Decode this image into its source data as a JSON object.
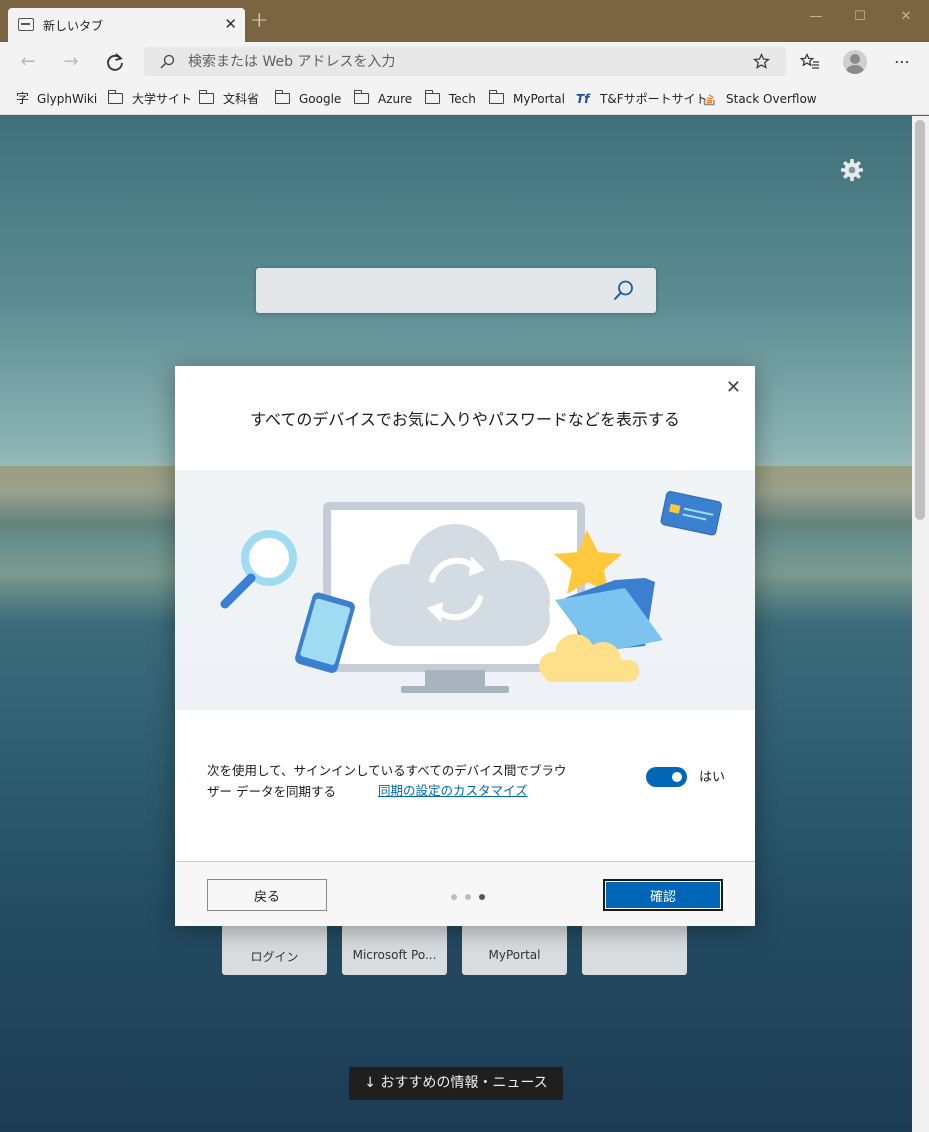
{
  "window": {
    "tab_title": "新しいタブ",
    "tab_close": "✕",
    "new_tab": "+",
    "controls": [
      "—",
      "☐",
      "✕"
    ]
  },
  "toolbar": {
    "back": "←",
    "forward": "→",
    "address_placeholder": "検索または Web アドレスを入力"
  },
  "bookmarks": [
    {
      "label": "GlyphWiki",
      "icon": "字"
    },
    {
      "label": "大学サイト",
      "icon": "folder-icon"
    },
    {
      "label": "文科省",
      "icon": "folder-icon"
    },
    {
      "label": "Google",
      "icon": "folder-icon"
    },
    {
      "label": "Azure",
      "icon": "folder-icon"
    },
    {
      "label": "Tech",
      "icon": "folder-icon"
    },
    {
      "label": "MyPortal",
      "icon": "folder-icon"
    },
    {
      "label": "T&Fサポートサイト",
      "icon": "tf-logo-icon"
    },
    {
      "label": "Stack Overflow",
      "icon": "stackoverflow-icon"
    }
  ],
  "newtab": {
    "tiles": [
      {
        "label": "ログイン"
      },
      {
        "label": "Microsoft Po..."
      },
      {
        "label": "MyPortal"
      },
      {
        "label": ""
      }
    ],
    "news_button": "↓  おすすめの情報・ニュース"
  },
  "dialog": {
    "close": "✕",
    "title": "すべてのデバイスでお気に入りやパスワードなどを表示する",
    "body_text": "次を使用して、サインインしているすべてのデバイス間でブラウザー データを同期する",
    "link": "同期の設定のカスタマイズ",
    "toggle_label": "はい",
    "toggle_on": true,
    "back_button": "戻る",
    "ok_button": "確認",
    "page_index": 3,
    "page_count": 3
  },
  "colors": {
    "accent": "#0067b8",
    "titlebar": "#7a6441"
  }
}
